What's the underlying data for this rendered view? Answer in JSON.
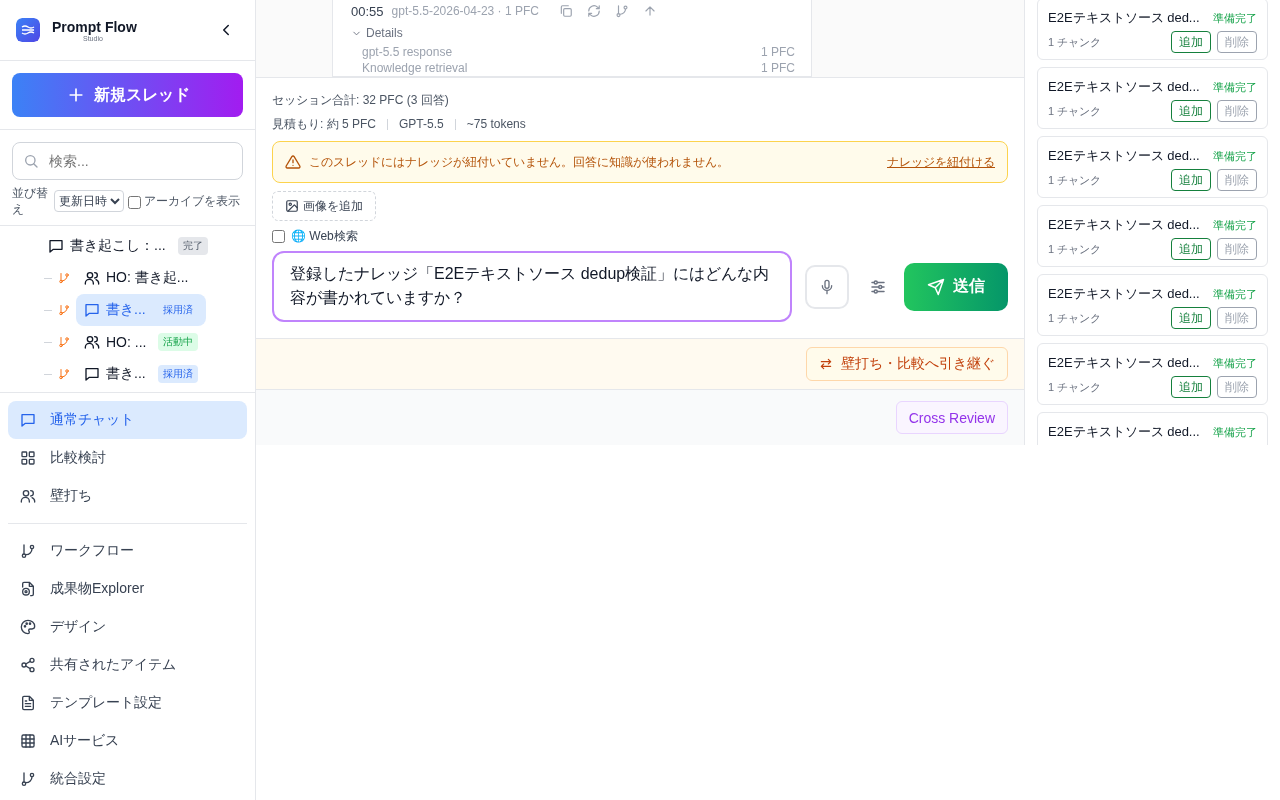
{
  "app": {
    "title": "Prompt Flow",
    "subtitle": "Studio"
  },
  "new_thread_button": "新規スレッド",
  "search": {
    "placeholder": "検索..."
  },
  "sort": {
    "label": "並び替え",
    "value": "更新日時"
  },
  "show_archive": {
    "label": "アーカイブを表示",
    "checked": false
  },
  "threads": [
    {
      "title": "書き起こし：...",
      "kind": "chat",
      "badge": "完了",
      "color": "#e5e7eb",
      "selected": false,
      "children": [
        {
          "title": "HO: 書き起...",
          "kind": "people",
          "selected": false
        },
        {
          "title": "書き...",
          "kind": "chat",
          "badge": "採用済",
          "color": "#dbeafe",
          "selected": true
        },
        {
          "title": "HO: ...",
          "kind": "people",
          "badge": "活動中",
          "color": "#dcfce7",
          "selected": false
        },
        {
          "title": "書き...",
          "kind": "chat",
          "badge": "採用済",
          "color": "#dbeafe",
          "selected": false
        }
      ]
    }
  ],
  "nav_groups": [
    [
      {
        "label": "通常チャット",
        "selected": true
      },
      {
        "label": "比較検討",
        "selected": false
      },
      {
        "label": "壁打ち",
        "selected": false
      }
    ],
    [
      {
        "label": "ワークフロー",
        "selected": false
      },
      {
        "label": "成果物Explorer",
        "selected": false
      },
      {
        "label": "デザイン",
        "selected": false
      },
      {
        "label": "共有されたアイテム",
        "selected": false
      },
      {
        "label": "テンプレート設定",
        "selected": false
      },
      {
        "label": "AIサービス",
        "selected": false
      },
      {
        "label": "統合設定",
        "selected": false
      }
    ]
  ],
  "message": {
    "time": "00:55",
    "meta": "gpt-5.5-2026-04-23 · 1 PFC",
    "details_label": "Details",
    "expanded": true,
    "details": [
      {
        "label": "gpt-5.5 response",
        "cost": "1 PFC"
      },
      {
        "label": "Knowledge retrieval",
        "cost": "1 PFC"
      }
    ]
  },
  "session_total": "セッション合計: 32 PFC (3 回答)",
  "estimate": [
    "見積もり: 約 5 PFC",
    "GPT-5.5",
    "~75 tokens"
  ],
  "warning": {
    "text": "このスレッドにはナレッジが紐付いていません。回答に知識が使われません。",
    "link": "ナレッジを紐付ける"
  },
  "add_image_button": "画像を追加",
  "web_search": {
    "label": "🌐 Web検索",
    "checked": false
  },
  "prompt": {
    "value": "登録したナレッジ「E2Eテキストソース dedup検証」にはどんな内容が書かれていますか？"
  },
  "send_button": "送信",
  "handoff_button": "壁打ち・比較へ引き継ぐ",
  "cross_review_button": "Cross Review",
  "knowledge": [
    {
      "title": "E2Eテキストソース ded...",
      "status": "準備完了",
      "chunks": "1 チャンク",
      "add": "追加",
      "remove": "削除"
    },
    {
      "title": "E2Eテキストソース ded...",
      "status": "準備完了",
      "chunks": "1 チャンク",
      "add": "追加",
      "remove": "削除"
    },
    {
      "title": "E2Eテキストソース ded...",
      "status": "準備完了",
      "chunks": "1 チャンク",
      "add": "追加",
      "remove": "削除"
    },
    {
      "title": "E2Eテキストソース ded...",
      "status": "準備完了",
      "chunks": "1 チャンク",
      "add": "追加",
      "remove": "削除"
    },
    {
      "title": "E2Eテキストソース ded...",
      "status": "準備完了",
      "chunks": "1 チャンク",
      "add": "追加",
      "remove": "削除"
    },
    {
      "title": "E2Eテキストソース ded...",
      "status": "準備完了",
      "chunks": "1 チャンク",
      "add": "追加",
      "remove": "削除"
    },
    {
      "title": "E2Eテキストソース ded...",
      "status": "準備完了"
    }
  ]
}
